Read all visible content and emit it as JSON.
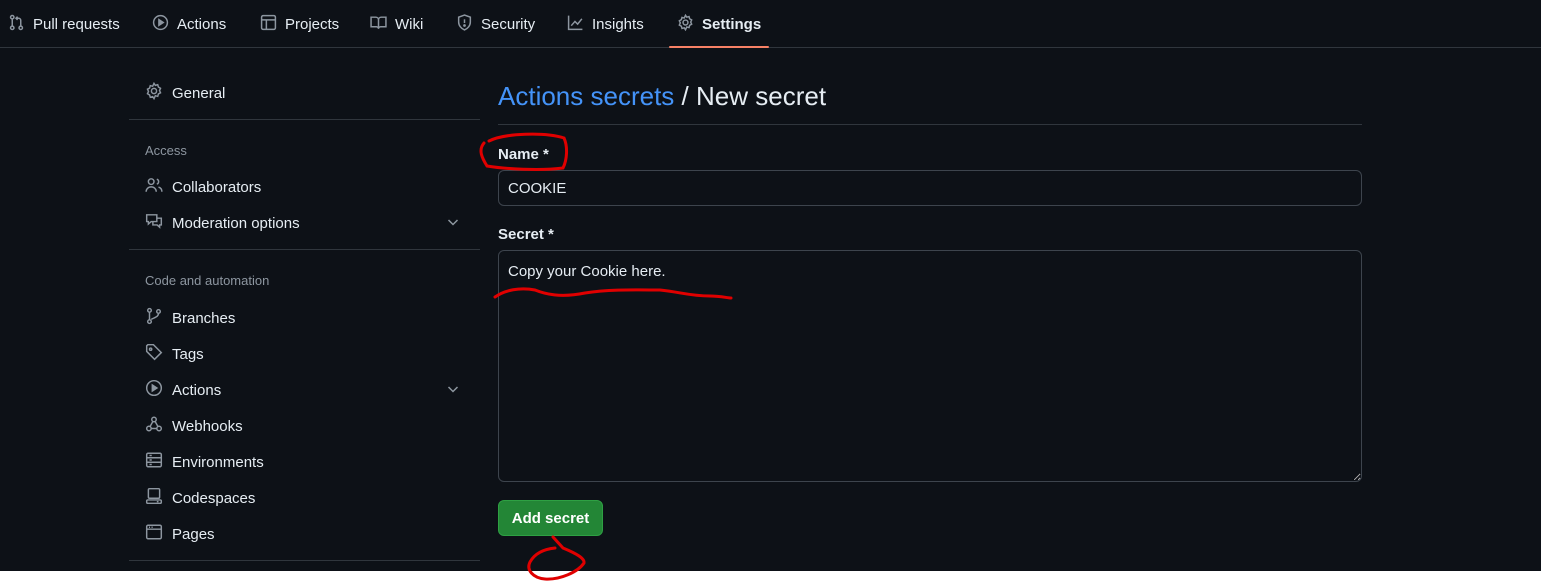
{
  "topnav": {
    "tabs": [
      {
        "label": "Pull requests",
        "icon": "pull-request-icon"
      },
      {
        "label": "Actions",
        "icon": "play-icon"
      },
      {
        "label": "Projects",
        "icon": "table-icon"
      },
      {
        "label": "Wiki",
        "icon": "book-icon"
      },
      {
        "label": "Security",
        "icon": "shield-icon"
      },
      {
        "label": "Insights",
        "icon": "graph-icon"
      },
      {
        "label": "Settings",
        "icon": "gear-icon",
        "active": true
      }
    ],
    "active_underline_color": "#f78166"
  },
  "sidebar": {
    "general": "General",
    "access_heading": "Access",
    "collaborators": "Collaborators",
    "moderation": "Moderation options",
    "code_heading": "Code and automation",
    "branches": "Branches",
    "tags": "Tags",
    "actions": "Actions",
    "webhooks": "Webhooks",
    "environments": "Environments",
    "codespaces": "Codespaces",
    "pages": "Pages"
  },
  "main": {
    "breadcrumb_link": "Actions secrets",
    "breadcrumb_sep": "/",
    "page_title": "New secret",
    "name_label": "Name *",
    "name_value": "COOKIE",
    "secret_label": "Secret *",
    "secret_value": "Copy your Cookie here.",
    "submit_label": "Add secret"
  },
  "colors": {
    "background": "#0d1117",
    "link": "#4493f8",
    "primary_button": "#238636",
    "annotation": "#e00000"
  }
}
